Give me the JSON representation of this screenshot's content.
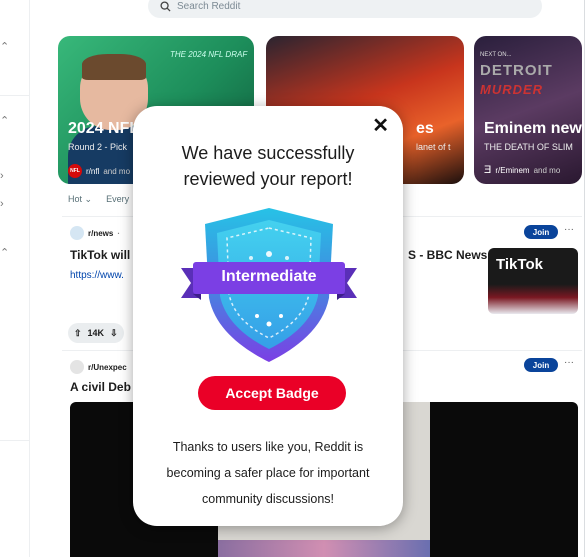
{
  "search": {
    "placeholder": "Search Reddit"
  },
  "cards": [
    {
      "title": "2024 NFL",
      "subtitle": "Round 2 - Pick",
      "community": "r/nfl",
      "community_suffix": "and mo",
      "banner": "THE 2024 NFL DRAF"
    },
    {
      "title": "es",
      "subtitle": "lanet of t",
      "community": "",
      "community_suffix": ""
    },
    {
      "title": "Eminem new",
      "subtitle": "THE DEATH OF SLIM",
      "community": "r/Eminem",
      "community_suffix": "and mo",
      "top": "NEXT ON...",
      "big": "DETROIT",
      "big2": "MURDER"
    }
  ],
  "sort": {
    "hot": "Hot",
    "everywhere": "Every"
  },
  "post1": {
    "community": "r/news",
    "title_left": "TikTok will",
    "title_right": "S - BBC News",
    "link": "https://www.",
    "join": "Join",
    "votes": "14K",
    "thumb_text": "TikTok"
  },
  "post2": {
    "community": "r/Unexpec",
    "title": "A civil Deb",
    "join": "Join"
  },
  "modal": {
    "close": "✕",
    "title_line1": "We have successfully",
    "title_line2": "reviewed your report!",
    "badge_label": "Intermediate",
    "accept": "Accept Badge",
    "body_line1": "Thanks to users like you, Reddit is",
    "body_line2": "becoming a safer place for important",
    "body_line3": "community discussions!"
  },
  "colors": {
    "accent": "#ea0027",
    "join": "#0a449b",
    "badge_purple": "#7b3fe4",
    "badge_cyan": "#27c2e6"
  }
}
